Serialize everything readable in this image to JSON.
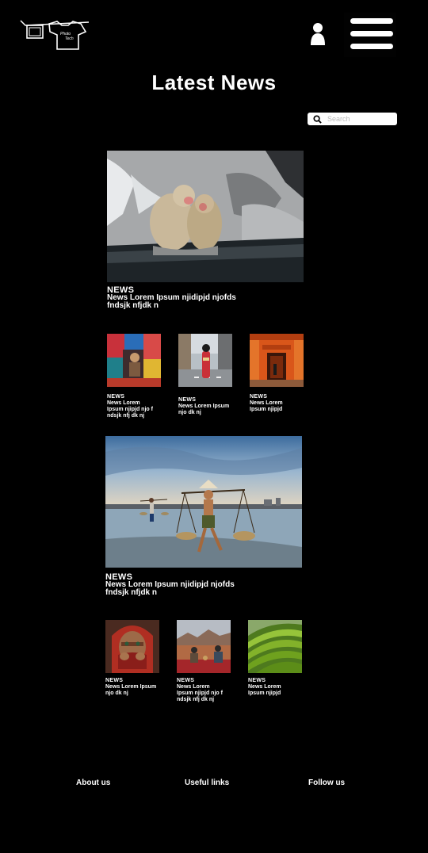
{
  "header": {
    "logo_text": "Photo Tech",
    "user_icon": "user-icon",
    "menu_icon": "hamburger-menu-icon"
  },
  "page": {
    "title": "Latest News"
  },
  "search": {
    "placeholder": "Search",
    "value": ""
  },
  "featured_1": {
    "tag": "NEWS",
    "text": "News Lorem Ipsum njidipjd njofds fndsjk nfjdk n",
    "image": "snow-monkeys-hot-spring"
  },
  "row_1": [
    {
      "tag": "NEWS",
      "text": "News Lorem Ipsum njipjd njo f ndsjk nfj dk nj",
      "image": "colorful-workshop-man"
    },
    {
      "tag": "NEWS",
      "text": "News Lorem Ipsum njo dk nj",
      "image": "geisha-street"
    },
    {
      "tag": "NEWS",
      "text": "News Lorem Ipsum njipjd",
      "image": "torii-gates-tunnel"
    }
  ],
  "featured_2": {
    "tag": "NEWS",
    "text": "News Lorem Ipsum njidipjd njofds fndsjk nfjdk n",
    "image": "beach-basket-carriers"
  },
  "row_2": [
    {
      "tag": "NEWS",
      "text": "News Lorem Ipsum njo dk nj",
      "image": "girl-red-scarf"
    },
    {
      "tag": "NEWS",
      "text": "News Lorem Ipsum njipjd njo f ndsjk nfj dk nj",
      "image": "desert-camp"
    },
    {
      "tag": "NEWS",
      "text": "News Lorem Ipsum njipjd",
      "image": "rice-terraces"
    }
  ],
  "footer": {
    "about": "About us",
    "links": "Useful links",
    "follow": "Follow us"
  }
}
